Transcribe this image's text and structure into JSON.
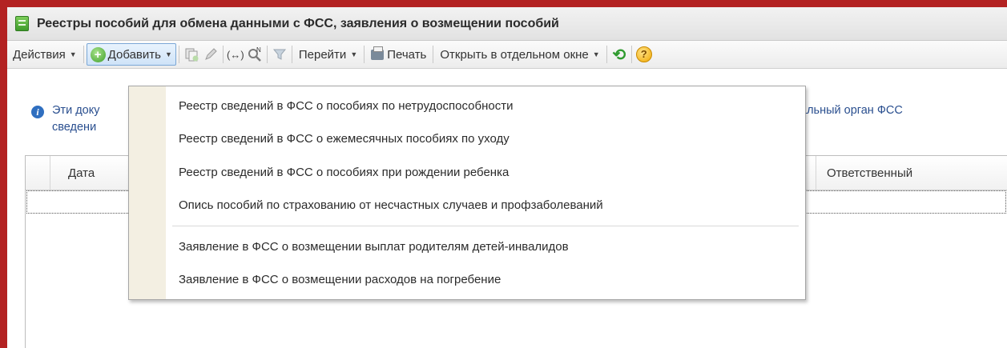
{
  "window": {
    "title": "Реестры пособий для обмена данными с ФСС, заявления о возмещении пособий"
  },
  "toolbar": {
    "actions_label": "Действия",
    "add_label": "Добавить",
    "goto_label": "Перейти",
    "print_label": "Печать",
    "open_window_label": "Открыть в отдельном окне"
  },
  "info": {
    "line1_start": "Эти доку",
    "line1_end": "альный орган ФСС",
    "line2_start": "сведени"
  },
  "table": {
    "columns": {
      "date": "Дата",
      "responsible": "Ответственный"
    }
  },
  "menu": {
    "items": [
      {
        "label": "Реестр сведений в ФСС о пособиях по нетрудоспособности"
      },
      {
        "label": "Реестр сведений в ФСС о ежемесячных пособиях по уходу"
      },
      {
        "label": "Реестр сведений в ФСС о пособиях при рождении ребенка"
      },
      {
        "label": "Опись пособий по страхованию от несчастных случаев и профзаболеваний"
      },
      {
        "label": "Заявление в ФСС о возмещении выплат родителям детей-инвалидов"
      },
      {
        "label": "Заявление в ФСС о возмещении расходов на погребение"
      }
    ]
  },
  "icons": {
    "app": "list-document-icon",
    "add": "plus-circle-icon",
    "copy": "copy-icon",
    "edit": "pencil-icon",
    "link": "link-icon",
    "find": "search-icon",
    "filter": "filter-icon",
    "print": "printer-icon",
    "refresh": "refresh-icon",
    "help": "help-icon",
    "info": "info-icon"
  }
}
